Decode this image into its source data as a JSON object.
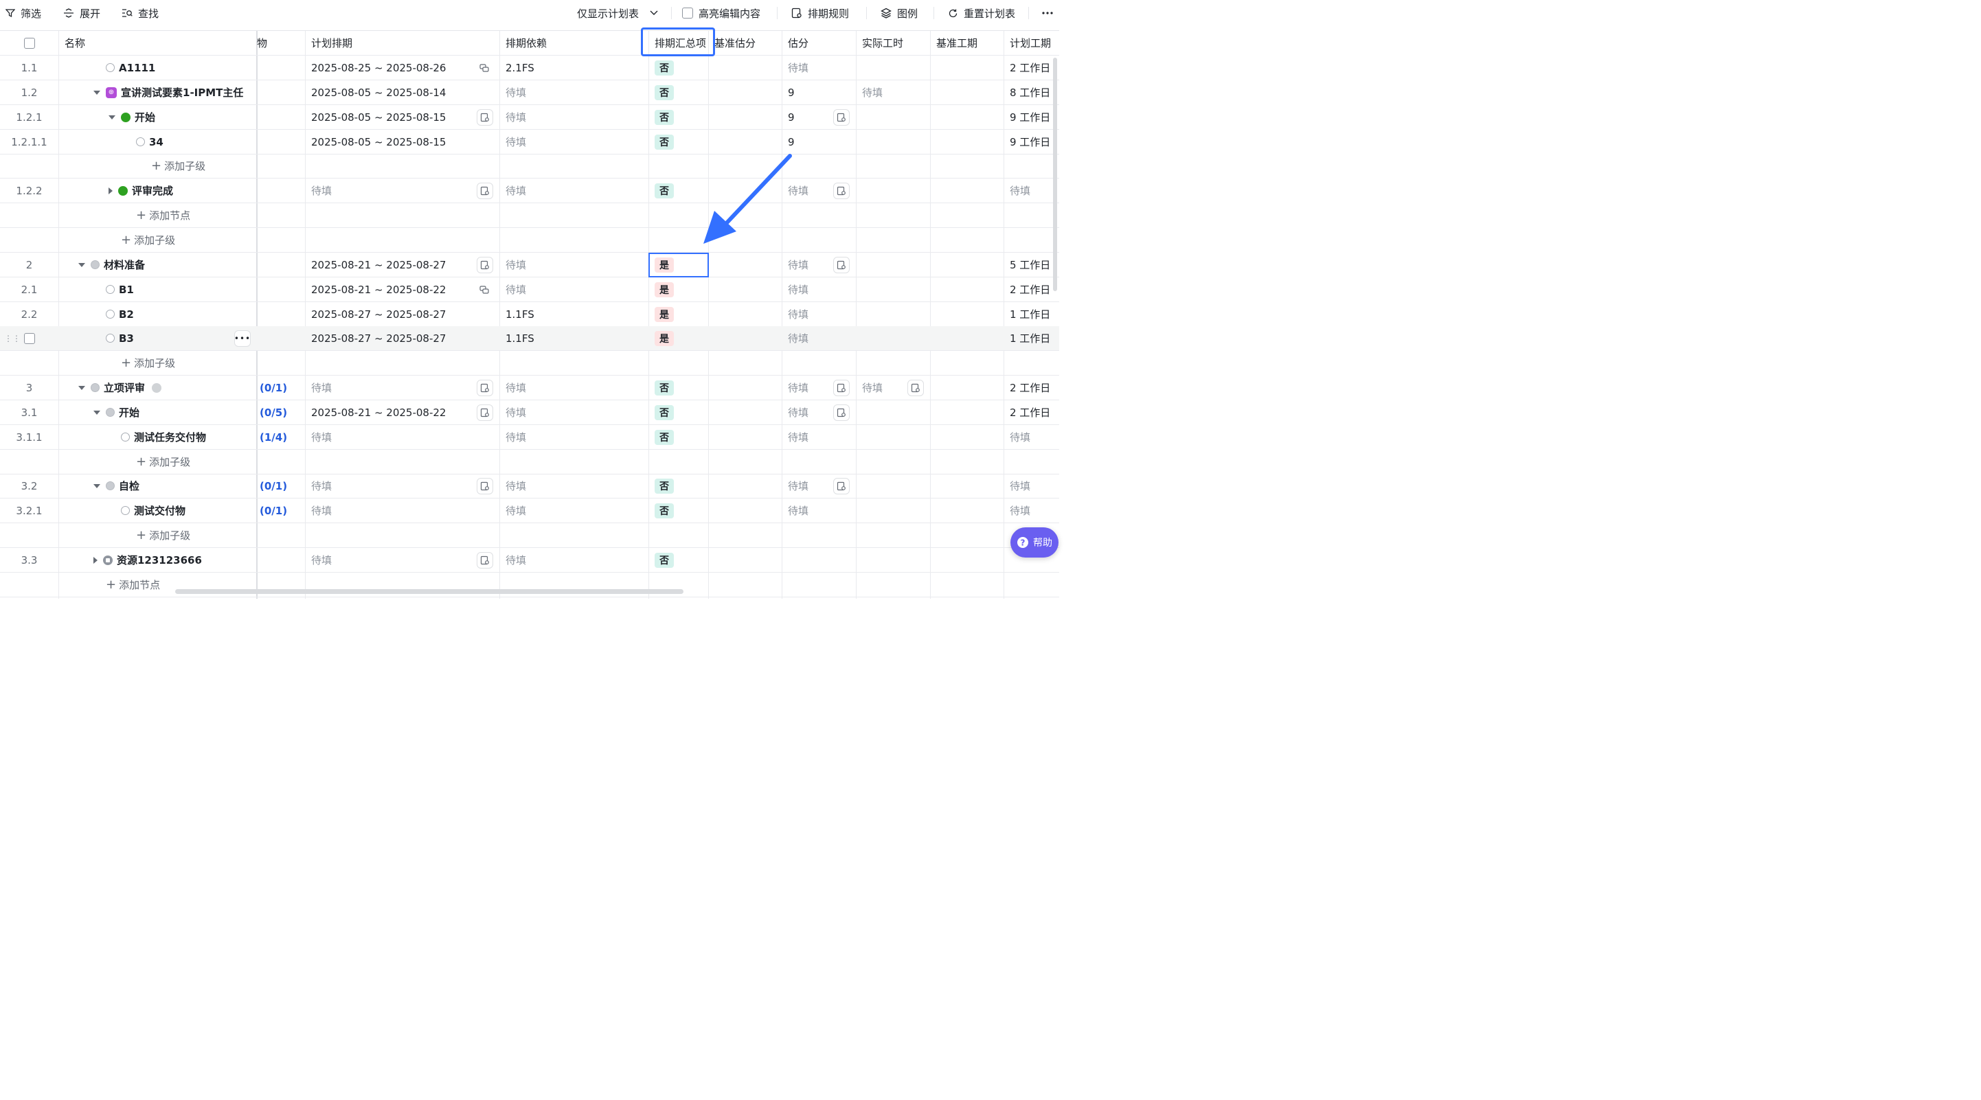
{
  "toolbar": {
    "filter": "筛选",
    "expand": "展开",
    "find": "查找",
    "plan_only": "仅显示计划表",
    "highlight_edits": "高亮编辑内容",
    "schedule_rules": "排期规则",
    "legend": "图例",
    "reset_plan": "重置计划表"
  },
  "columns": {
    "name": "名称",
    "deliverable": "物",
    "plan_schedule": "计划排期",
    "dependency": "排期依赖",
    "summary_item": "排期汇总项",
    "baseline_estimate": "基准估分",
    "estimate": "估分",
    "actual_hours": "实际工时",
    "baseline_duration": "基准工期",
    "plan_duration": "计划工期"
  },
  "rows": [
    {
      "num": "1.1",
      "name": "A1111",
      "status": "empty",
      "indent": 1,
      "schedule": "2025-08-25 ~ 2025-08-26",
      "dep": "2.1FS",
      "summary": "否",
      "estimate": "待填",
      "duration": "2 工作日"
    },
    {
      "num": "1.2",
      "name": "宣讲测试要素1-IPMT主任",
      "status": "purple",
      "indent": 1,
      "caret": "down",
      "schedule": "2025-08-05 ~ 2025-08-14",
      "dep": "待填",
      "summary": "否",
      "estimate": "9",
      "actual": "待填",
      "duration": "8 工作日"
    },
    {
      "num": "1.2.1",
      "name": "开始",
      "status": "green",
      "indent": 2,
      "caret": "down",
      "schedule": "2025-08-05 ~ 2025-08-15",
      "dep": "待填",
      "summary": "否",
      "estimate": "9",
      "duration": "9 工作日"
    },
    {
      "num": "1.2.1.1",
      "name": "34",
      "status": "empty",
      "indent": 3,
      "schedule": "2025-08-05 ~ 2025-08-15",
      "dep": "待填",
      "summary": "否",
      "estimate": "9",
      "duration": "9 工作日"
    },
    {
      "add": "添加子级",
      "indent": 3
    },
    {
      "num": "1.2.2",
      "name": "评审完成",
      "status": "green",
      "indent": 2,
      "caret": "right",
      "schedule": "待填",
      "dep": "待填",
      "summary": "否",
      "estimate": "待填",
      "duration": "待填"
    },
    {
      "add": "添加节点",
      "indent": 2
    },
    {
      "add": "添加子级",
      "indent": 1
    },
    {
      "num": "2",
      "name": "材料准备",
      "status": "gray",
      "indent": 0,
      "caret": "down",
      "schedule": "2025-08-21 ~ 2025-08-27",
      "dep": "待填",
      "summary": "是",
      "estimate": "待填",
      "duration": "5 工作日"
    },
    {
      "num": "2.1",
      "name": "B1",
      "status": "empty",
      "indent": 1,
      "schedule": "2025-08-21 ~ 2025-08-22",
      "dep": "待填",
      "summary": "是",
      "estimate": "待填",
      "duration": "2 工作日"
    },
    {
      "num": "2.2",
      "name": "B2",
      "status": "empty",
      "indent": 1,
      "schedule": "2025-08-27 ~ 2025-08-27",
      "dep": "1.1FS",
      "summary": "是",
      "estimate": "待填",
      "duration": "1 工作日"
    },
    {
      "num": "",
      "name": "B3",
      "status": "empty",
      "indent": 1,
      "schedule": "2025-08-27 ~ 2025-08-27",
      "dep": "1.1FS",
      "summary": "是",
      "estimate": "待填",
      "duration": "1 工作日"
    },
    {
      "add": "添加子级",
      "indent": 1
    },
    {
      "num": "3",
      "name": "立项评审",
      "status": "gray",
      "indent": 0,
      "caret": "down",
      "progress": "(0/1)",
      "schedule": "待填",
      "dep": "待填",
      "summary": "否",
      "estimate": "待填",
      "actual": "待填",
      "duration": "2 工作日"
    },
    {
      "num": "3.1",
      "name": "开始",
      "status": "gray",
      "indent": 1,
      "caret": "down",
      "progress": "(0/5)",
      "schedule": "2025-08-21 ~ 2025-08-22",
      "dep": "待填",
      "summary": "否",
      "estimate": "待填",
      "duration": "2 工作日"
    },
    {
      "num": "3.1.1",
      "name": "测试任务交付物",
      "status": "empty",
      "indent": 2,
      "progress": "(1/4)",
      "schedule": "待填",
      "dep": "待填",
      "summary": "否",
      "estimate": "待填",
      "duration": "待填"
    },
    {
      "add": "添加子级",
      "indent": 2
    },
    {
      "num": "3.2",
      "name": "自检",
      "status": "gray",
      "indent": 1,
      "caret": "down",
      "progress": "(0/1)",
      "schedule": "待填",
      "dep": "待填",
      "summary": "否",
      "estimate": "待填",
      "duration": "待填"
    },
    {
      "num": "3.2.1",
      "name": "测试交付物",
      "status": "empty",
      "indent": 2,
      "progress": "(0/1)",
      "schedule": "待填",
      "dep": "待填",
      "summary": "否",
      "estimate": "待填",
      "duration": "待填"
    },
    {
      "add": "添加子级",
      "indent": 2
    },
    {
      "num": "3.3",
      "name": "资源123123666",
      "status": "grayres",
      "indent": 1,
      "caret": "right",
      "schedule": "待填",
      "dep": "待填",
      "summary": "否"
    },
    {
      "add": "添加节点",
      "indent": 0
    }
  ],
  "help": "帮助",
  "colors": {
    "accent": "#3370ff",
    "no_tag": "#d5f2ec",
    "yes_tag": "#fde2e2",
    "progress": "#245bdb"
  }
}
